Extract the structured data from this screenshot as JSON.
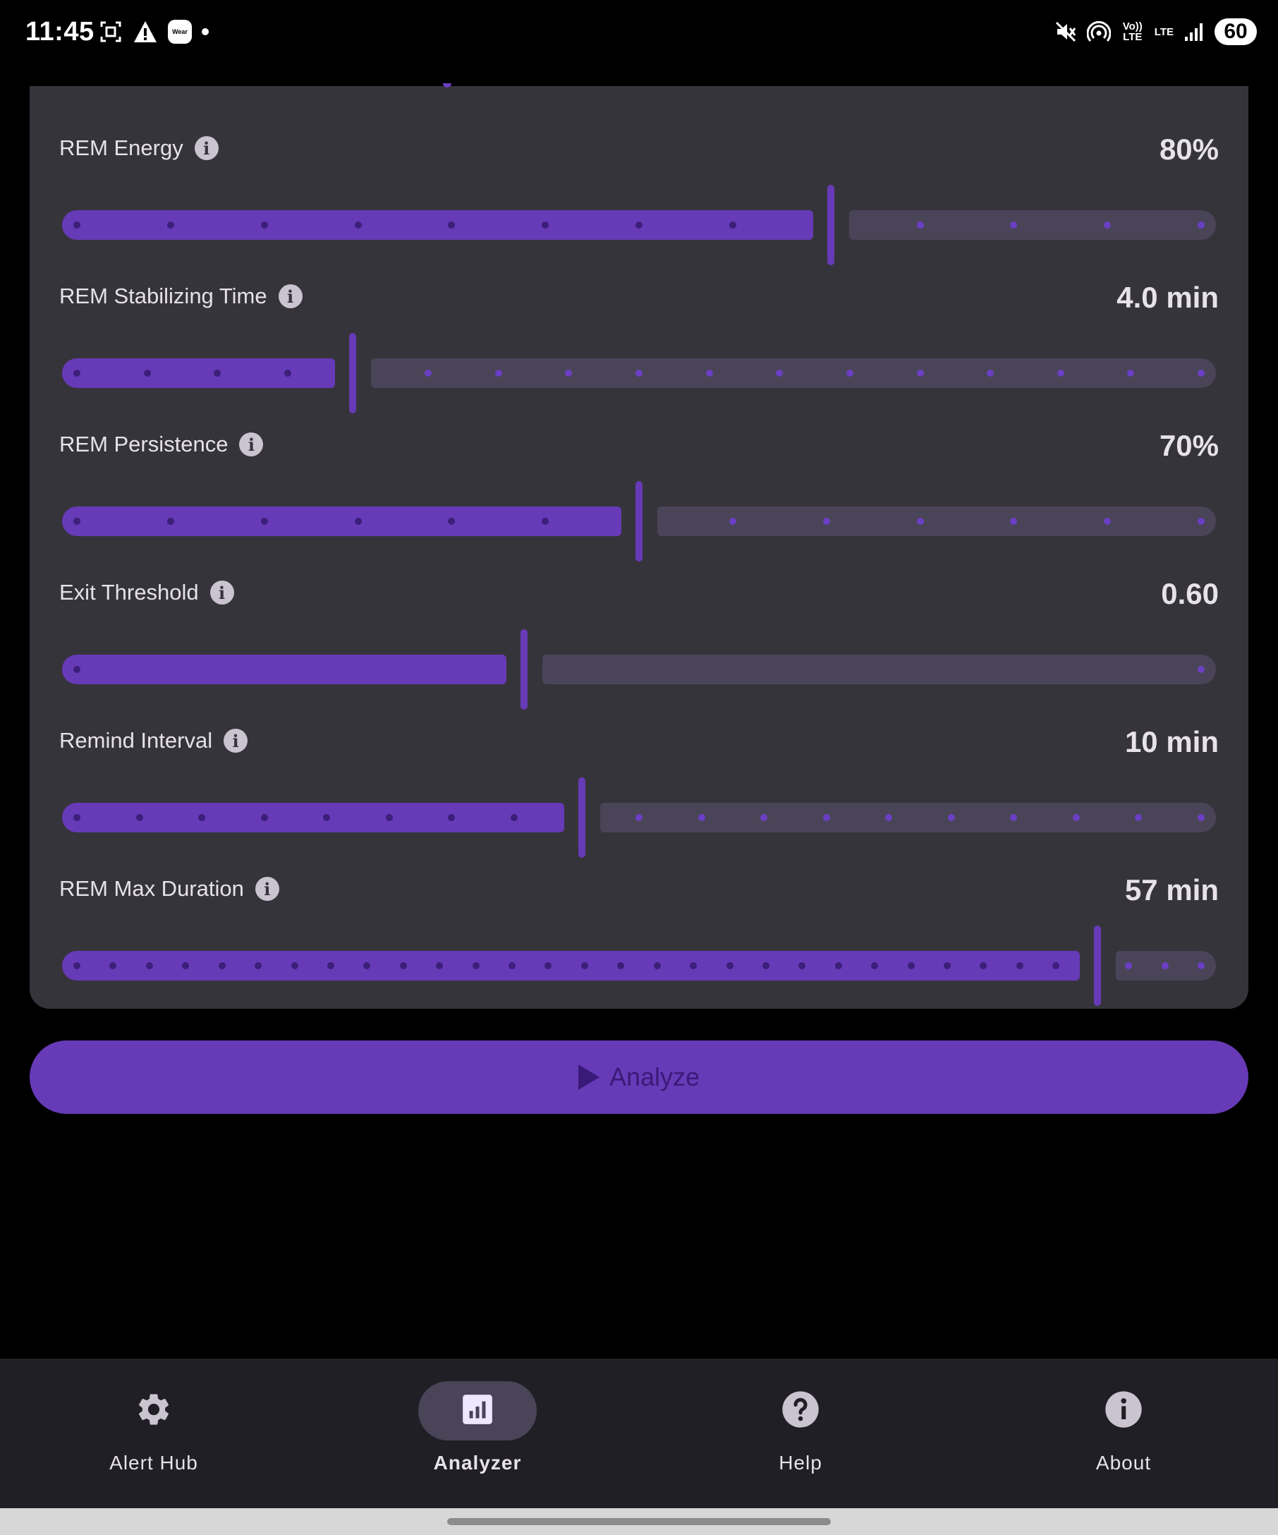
{
  "status_bar": {
    "time": "11:45",
    "left_icons": [
      "screenshot-icon",
      "warning-icon",
      "wear-icon",
      "notification-dot-icon"
    ],
    "wear_text": "Wear",
    "right_icons": [
      "mute-icon",
      "hotspot-icon",
      "volte-icon",
      "lte-icon",
      "signal-icon",
      "battery-icon"
    ],
    "volte_text": "Vo)) LTE",
    "lte_text": "LTE",
    "battery": "60"
  },
  "settings": [
    {
      "label": "REM Energy",
      "value": "80%",
      "fraction": 0.667,
      "ticks": 13
    },
    {
      "label": "REM Stabilizing Time",
      "value": "4.0 min",
      "fraction": 0.25,
      "ticks": 17
    },
    {
      "label": "REM Persistence",
      "value": "70%",
      "fraction": 0.5,
      "ticks": 13
    },
    {
      "label": "Exit Threshold",
      "value": "0.60",
      "fraction": 0.4,
      "ticks": 2
    },
    {
      "label": "Remind Interval",
      "value": "10 min",
      "fraction": 0.45,
      "ticks": 19
    },
    {
      "label": "REM Max Duration",
      "value": "57 min",
      "fraction": 0.9,
      "ticks": 32
    }
  ],
  "analyze_button": {
    "label": "Analyze"
  },
  "nav": {
    "items": [
      {
        "label": "Alert Hub",
        "icon": "gear-icon"
      },
      {
        "label": "Analyzer",
        "icon": "analytics-icon"
      },
      {
        "label": "Help",
        "icon": "help-icon"
      },
      {
        "label": "About",
        "icon": "info-icon"
      }
    ],
    "active": "Analyzer"
  },
  "colors": {
    "accent": "#673ab7",
    "track_inactive": "#4a4458",
    "card": "#36343b",
    "nav_bg": "#211f26"
  }
}
